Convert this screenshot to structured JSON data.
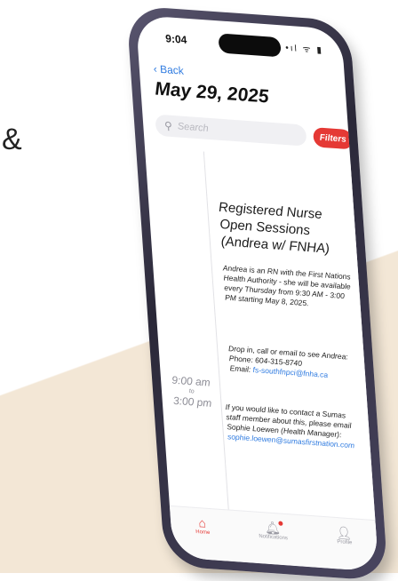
{
  "decor": {
    "ampersand": "&"
  },
  "status": {
    "time": "9:04",
    "icons": "•ıl ᯤ ▮"
  },
  "nav": {
    "back_label": "‹ Back"
  },
  "page": {
    "date_title": "May 29, 2025"
  },
  "search": {
    "placeholder": "Search",
    "icon": "search-icon"
  },
  "filters": {
    "label": "Filters",
    "color": "#e53935"
  },
  "event": {
    "start_time": "9:00 am",
    "to_label": "to",
    "end_time": "3:00 pm",
    "title": "Registered Nurse Open Sessions (Andrea w/ FNHA)",
    "description": "Andrea is an RN with the First Nations Health Authority - she will be available every Thursday from 9:30 AM - 3:00 PM starting May 8, 2025.",
    "contact_intro": "Drop in, call or email to see Andrea:",
    "phone_line": "Phone: 604-315-8740",
    "email_prefix": "Email: ",
    "email": "fs-southfnpci@fnha.ca",
    "staff_text": "If you would like to contact a Sumas staff member about this, please email Sophie Loewen (Health Manager):",
    "staff_email": "sophie.loewen@sumasfirstnation.com"
  },
  "tabbar": {
    "home": {
      "label": "Home",
      "icon": "home-icon"
    },
    "notifications": {
      "label": "Notifications",
      "icon": "bell-icon"
    },
    "profile": {
      "label": "Profile",
      "icon": "person-icon"
    }
  },
  "colors": {
    "accent": "#e53935",
    "link": "#2f7be0",
    "backdrop": "#f3e7d6"
  }
}
